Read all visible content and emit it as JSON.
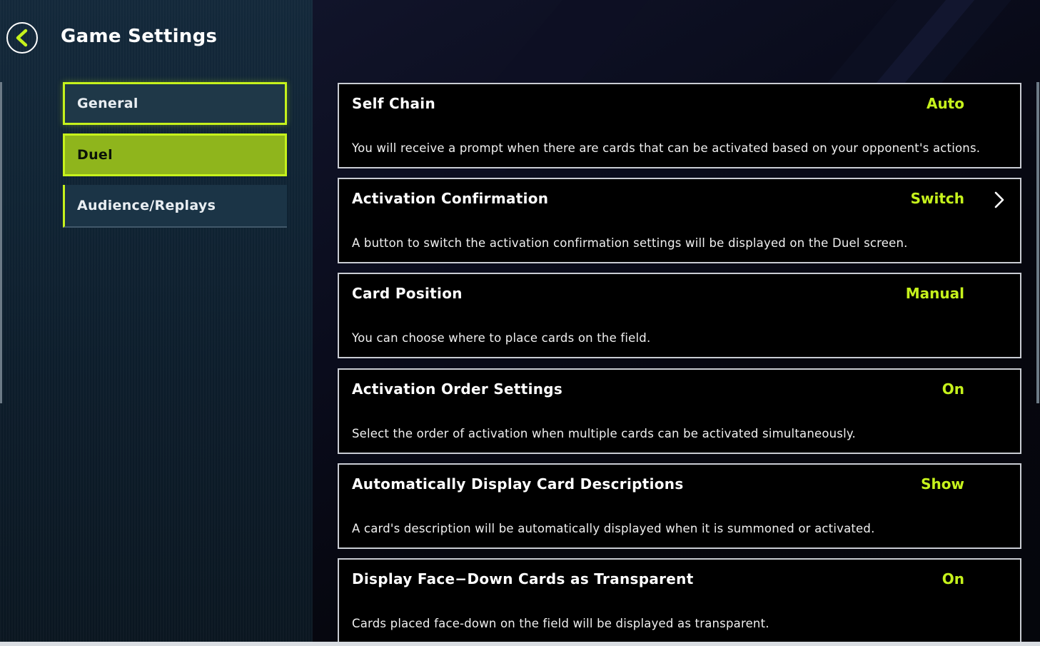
{
  "header": {
    "title": "Game Settings",
    "back_icon": "chevron-left-icon"
  },
  "sidebar": {
    "items": [
      {
        "label": "General",
        "state": "focused"
      },
      {
        "label": "Duel",
        "state": "selected"
      },
      {
        "label": "Audience/Replays",
        "state": "default"
      }
    ]
  },
  "settings": [
    {
      "title": "Self Chain",
      "value": "Auto",
      "description": "You will receive a prompt when there are cards that can be activated based on your opponent's actions."
    },
    {
      "title": "Activation Confirmation",
      "value": "Switch",
      "description": "A button to switch the activation confirmation settings will be displayed on the Duel screen.",
      "icon": "chevron-right-icon"
    },
    {
      "title": "Card Position",
      "value": "Manual",
      "description": "You can choose where to place cards on the field."
    },
    {
      "title": "Activation Order Settings",
      "value": "On",
      "description": "Select the order of activation when multiple cards can be activated simultaneously."
    },
    {
      "title": "Automatically Display Card Descriptions",
      "value": "Show",
      "description": "A card's description will be automatically displayed when it is summoned or activated."
    },
    {
      "title": "Display Face−Down Cards as Transparent",
      "value": "On",
      "description": "Cards placed face-down on the field will be displayed as transparent."
    }
  ],
  "colors": {
    "accent": "#c6f21c",
    "selected_bg": "#8fb51c",
    "card_border": "#c9ccd3",
    "sidebar_bg": "#0f2333"
  }
}
